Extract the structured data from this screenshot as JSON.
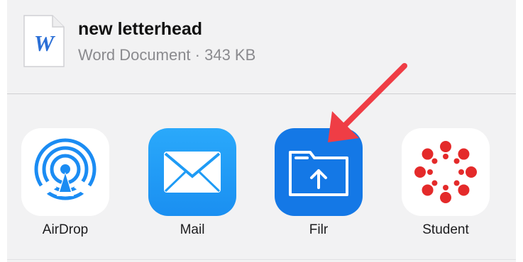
{
  "file": {
    "name": "new letterhead",
    "type_size": "Word Document · 343 KB",
    "icon": "word-document-icon",
    "icon_letter": "W"
  },
  "apps": [
    {
      "label": "AirDrop",
      "icon": "airdrop-icon"
    },
    {
      "label": "Mail",
      "icon": "mail-icon"
    },
    {
      "label": "Filr",
      "icon": "filr-icon"
    },
    {
      "label": "Student",
      "icon": "canvas-student-icon"
    }
  ],
  "colors": {
    "sheet_bg": "#f2f2f3",
    "airdrop_blue": "#1b8cf3",
    "mail_blue": "#1e9bf5",
    "filr_blue": "#1478e6",
    "student_red": "#e42a2a",
    "annotation_arrow": "#ef3d45",
    "word_blue": "#2b6fd6"
  }
}
